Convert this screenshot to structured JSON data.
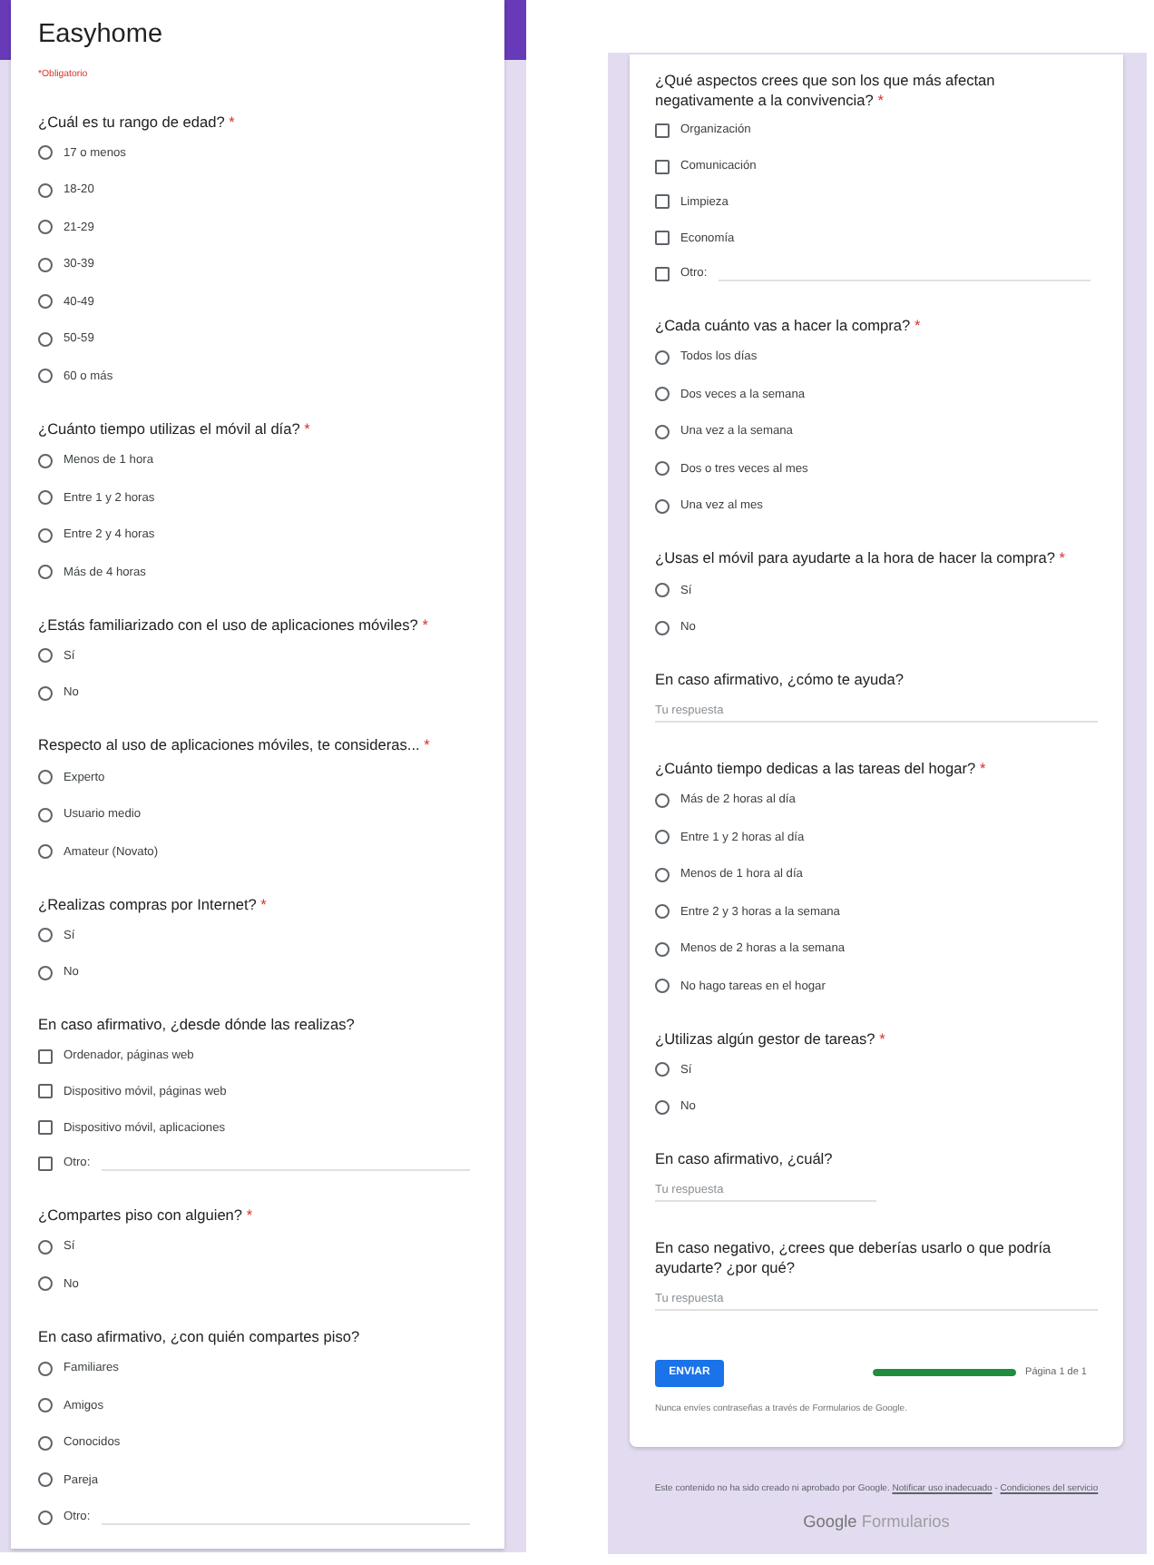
{
  "panels": [
    {
      "header": {
        "title": "Easyhome",
        "required_note": "*Obligatorio"
      },
      "questions": [
        {
          "kind": "radio",
          "text": "¿Cuál es tu rango de edad?",
          "required_mark": "*",
          "options": [
            {
              "label": "17 o menos",
              "selected": false
            },
            {
              "label": "18-20",
              "selected": false
            },
            {
              "label": "21-29",
              "selected": false
            },
            {
              "label": "30-39",
              "selected": false
            },
            {
              "label": "40-49",
              "selected": false
            },
            {
              "label": "50-59",
              "selected": false
            },
            {
              "label": "60 o más",
              "selected": false
            }
          ]
        },
        {
          "kind": "radio",
          "text": "¿Cuánto tiempo utilizas el móvil al día?",
          "required_mark": "*",
          "options": [
            {
              "label": "Menos de 1 hora",
              "selected": false
            },
            {
              "label": "Entre 1 y 2 horas",
              "selected": false
            },
            {
              "label": "Entre 2 y 4 horas",
              "selected": false
            },
            {
              "label": "Más de 4 horas",
              "selected": false
            }
          ]
        },
        {
          "kind": "radio",
          "text": "¿Estás familiarizado con el uso de aplicaciones móviles?",
          "required_mark": "*",
          "options": [
            {
              "label": "Sí",
              "selected": false
            },
            {
              "label": "No",
              "selected": false
            }
          ]
        },
        {
          "kind": "radio",
          "text": "Respecto al uso de aplicaciones móviles, te consideras...",
          "required_mark": "*",
          "options": [
            {
              "label": "Experto",
              "selected": false
            },
            {
              "label": "Usuario medio",
              "selected": false
            },
            {
              "label": "Amateur (Novato)",
              "selected": false
            }
          ]
        },
        {
          "kind": "radio",
          "text": "¿Realizas compras por Internet?",
          "required_mark": "*",
          "options": [
            {
              "label": "Sí",
              "selected": false
            },
            {
              "label": "No",
              "selected": false
            }
          ]
        },
        {
          "kind": "checkbox",
          "text": "En caso afirmativo, ¿desde dónde las realizas?",
          "options": [
            {
              "label": "Ordenador, páginas web",
              "checked": false
            },
            {
              "label": "Dispositivo móvil, páginas web",
              "checked": false
            },
            {
              "label": "Dispositivo móvil, aplicaciones",
              "checked": false
            }
          ],
          "other": {
            "label": "Otro:",
            "checked": false
          }
        },
        {
          "kind": "radio",
          "text": "¿Compartes piso con alguien?",
          "required_mark": "*",
          "options": [
            {
              "label": "Sí",
              "selected": false
            },
            {
              "label": "No",
              "selected": false
            }
          ]
        },
        {
          "kind": "radio",
          "text": "En caso afirmativo, ¿con quién compartes piso?",
          "options": [
            {
              "label": "Familiares",
              "selected": false
            },
            {
              "label": "Amigos",
              "selected": false
            },
            {
              "label": "Conocidos",
              "selected": false
            },
            {
              "label": "Pareja",
              "selected": false
            }
          ],
          "other": {
            "label": "Otro:",
            "selected": false
          }
        }
      ]
    },
    {
      "questions": [
        {
          "kind": "checkbox",
          "text": "¿Qué aspectos crees que son los que más afectan negativamente a la convivencia?",
          "required_mark": "*",
          "options": [
            {
              "label": "Organización",
              "checked": false
            },
            {
              "label": "Comunicación",
              "checked": false
            },
            {
              "label": "Limpieza",
              "checked": false
            },
            {
              "label": "Economía",
              "checked": false
            }
          ],
          "other": {
            "label": "Otro:",
            "checked": false
          }
        },
        {
          "kind": "radio",
          "text": "¿Cada cuánto vas a hacer la compra?",
          "required_mark": "*",
          "options": [
            {
              "label": "Todos los días",
              "selected": false
            },
            {
              "label": "Dos veces a la semana",
              "selected": false
            },
            {
              "label": "Una vez a la semana",
              "selected": false
            },
            {
              "label": "Dos o tres veces al mes",
              "selected": false
            },
            {
              "label": "Una vez al mes",
              "selected": false
            }
          ]
        },
        {
          "kind": "radio",
          "text": "¿Usas el móvil para ayudarte a la hora de hacer la compra?",
          "required_mark": "*",
          "options": [
            {
              "label": "Sí",
              "selected": false
            },
            {
              "label": "No",
              "selected": false
            }
          ]
        },
        {
          "kind": "paragraph",
          "text": "En caso afirmativo, ¿cómo te ayuda?",
          "placeholder": "Tu respuesta"
        },
        {
          "kind": "radio",
          "text": "¿Cuánto tiempo dedicas a las tareas del hogar?",
          "required_mark": "*",
          "options": [
            {
              "label": "Más de 2 horas al día",
              "selected": false
            },
            {
              "label": "Entre 1 y 2 horas al día",
              "selected": false
            },
            {
              "label": "Menos de 1 hora al día",
              "selected": false
            },
            {
              "label": "Entre 2 y 3 horas a la semana",
              "selected": false
            },
            {
              "label": "Menos de 2 horas a la semana",
              "selected": false
            },
            {
              "label": "No hago tareas en el hogar",
              "selected": false
            }
          ]
        },
        {
          "kind": "radio",
          "text": "¿Utilizas algún gestor de tareas?",
          "required_mark": "*",
          "options": [
            {
              "label": "Sí",
              "selected": false
            },
            {
              "label": "No",
              "selected": false
            }
          ]
        },
        {
          "kind": "short_text",
          "text": "En caso afirmativo, ¿cuál?",
          "placeholder": "Tu respuesta"
        },
        {
          "kind": "paragraph",
          "text": "En caso negativo, ¿crees que deberías usarlo o que podría ayudarte? ¿por qué?",
          "placeholder": "Tu respuesta"
        }
      ],
      "submit": {
        "label": "ENVIAR"
      },
      "progress": {
        "level": 1,
        "label": "Página 1 de 1"
      },
      "password_note": "Nunca envíes contraseñas a través de Formularios de Google.",
      "footer": {
        "disclaimer": "Este contenido no ha sido creado ni aprobado por Google.",
        "links": [
          "Notificar uso inadecuado",
          "Condiciones del servicio"
        ],
        "separator": "-",
        "logo": {
          "brand": "Google",
          "product": "Formularios"
        }
      }
    }
  ]
}
